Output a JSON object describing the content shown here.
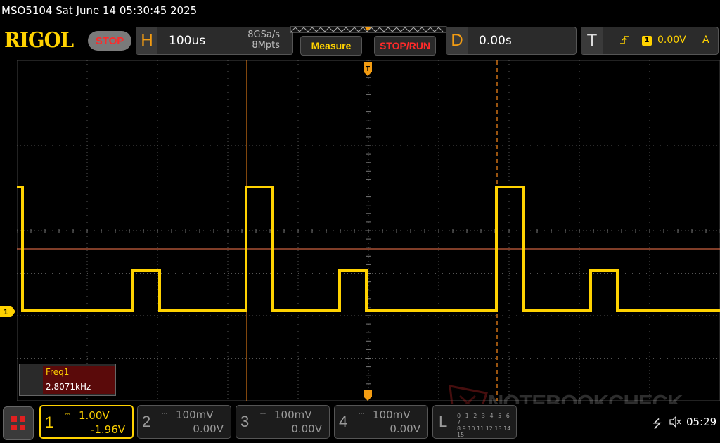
{
  "title": "MSO5104  Sat June 14 05:30:45 2025",
  "logo": "RIGOL",
  "run_state": "STOP",
  "horizontal": {
    "letter": "H",
    "timebase": "100us",
    "sample_rate": "8GSa/s",
    "memory_depth": "8Mpts"
  },
  "buttons": {
    "measure": "Measure",
    "stop_run": "STOP/RUN"
  },
  "delay": {
    "letter": "D",
    "value": "0.00s"
  },
  "trigger": {
    "letter": "T",
    "edge_icon": "rising-edge-icon",
    "source": "1",
    "level": "0.00V",
    "mode": "A"
  },
  "measurement": {
    "label": "Freq1",
    "value": "2.8071kHz"
  },
  "channel_marker": "1",
  "channels": [
    {
      "num": "1",
      "scale": "1.00V",
      "offset": "-1.96V",
      "active": true
    },
    {
      "num": "2",
      "scale": "100mV",
      "offset": "0.00V",
      "active": false
    },
    {
      "num": "3",
      "scale": "100mV",
      "offset": "0.00V",
      "active": false
    },
    {
      "num": "4",
      "scale": "100mV",
      "offset": "0.00V",
      "active": false
    }
  ],
  "logic": {
    "letter": "L",
    "row1": "0 1 2 3 4 5 6 7",
    "row2": "8 9 10 11 12 13 14 15"
  },
  "watermark": "NOTEBOOKCHECK",
  "status": {
    "usb_icon": "usb-icon",
    "mute_icon": "speaker-mute-icon",
    "time": "05:29"
  },
  "colors": {
    "ch1": "#ffd200",
    "trigger_line": "#ff7a50",
    "cursor": "#ff8c1a",
    "stop": "#ff2a2a",
    "accent": "#f39c12"
  },
  "waveform": {
    "low_level": -2.0,
    "pulse_levels": [
      2.0,
      1.0
    ],
    "period_us": 356.0,
    "pulses": [
      {
        "start_us": 0.0,
        "width_us": 14,
        "level": "high"
      },
      {
        "start_us": 165.0,
        "width_us": 20,
        "level": "mid"
      },
      {
        "start_us": 326.0,
        "width_us": 20,
        "level": "high"
      },
      {
        "start_us": 459.0,
        "width_us": 20,
        "level": "mid"
      },
      {
        "start_us": 682.0,
        "width_us": 20,
        "level": "high"
      },
      {
        "start_us": 816.0,
        "width_us": 20,
        "level": "mid"
      }
    ]
  }
}
